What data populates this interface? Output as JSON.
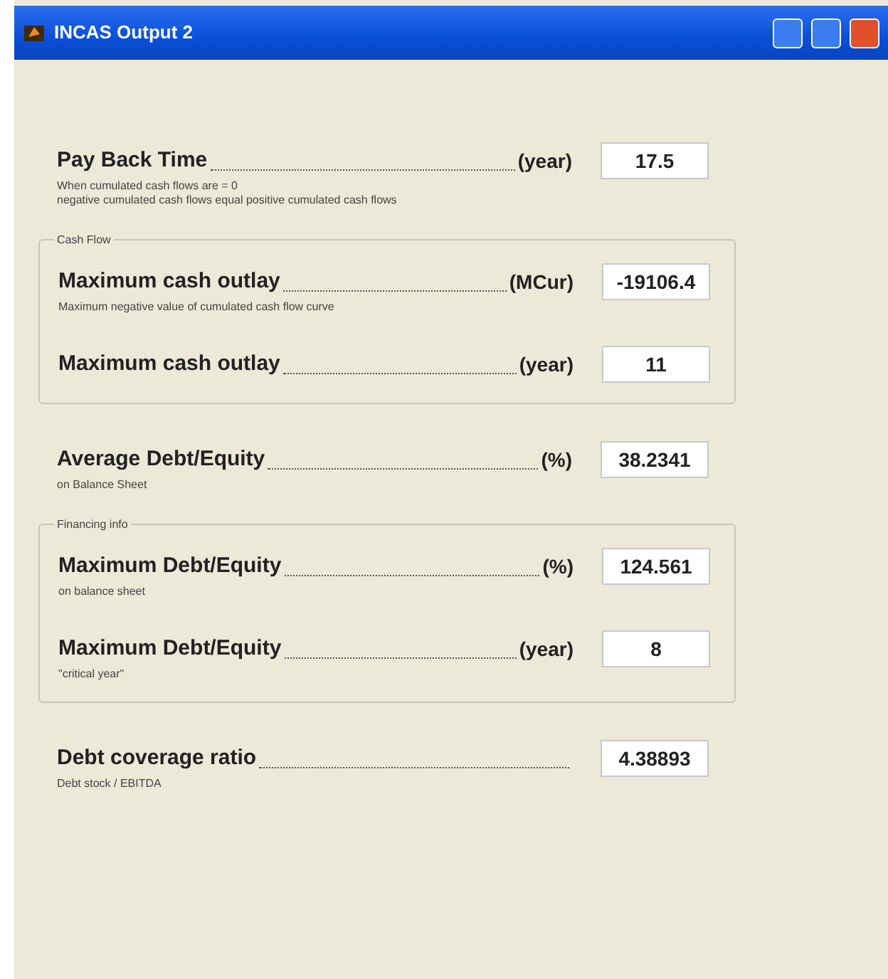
{
  "window": {
    "title": "INCAS Output 2"
  },
  "sections": [
    {
      "kind": "row",
      "label": "Pay Back Time",
      "unit": "(year)",
      "value": "17.5",
      "notes": [
        "When cumulated cash flows are = 0",
        "negative cumulated cash flows equal positive cumulated cash flows"
      ]
    },
    {
      "kind": "group",
      "title": "Cash Flow",
      "rows": [
        {
          "label": "Maximum cash outlay",
          "unit": "(MCur)",
          "value": "-19106.4",
          "notes": [
            "Maximum negative value of cumulated cash flow curve"
          ]
        },
        {
          "label": "Maximum cash outlay",
          "unit": "(year)",
          "value": "11",
          "notes": []
        }
      ]
    },
    {
      "kind": "row",
      "label": "Average Debt/Equity",
      "unit": "(%)",
      "value": "38.2341",
      "notes": [
        "on Balance Sheet"
      ]
    },
    {
      "kind": "group",
      "title": "Financing info",
      "rows": [
        {
          "label": "Maximum Debt/Equity ",
          "unit": "(%)",
          "value": "124.561",
          "notes": [
            "on balance sheet"
          ]
        },
        {
          "label": "Maximum Debt/Equity",
          "unit": "(year)",
          "value": "8",
          "notes": [
            "\"critical year\""
          ]
        }
      ]
    },
    {
      "kind": "row",
      "label": "Debt coverage ratio",
      "value": "4.38893",
      "notes": [
        "Debt stock / EBITDA"
      ]
    }
  ]
}
